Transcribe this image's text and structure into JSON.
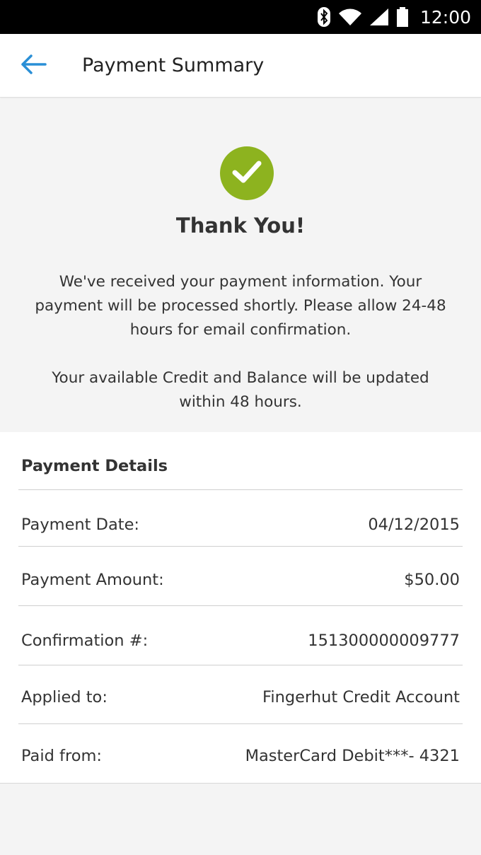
{
  "status_bar": {
    "time": "12:00",
    "icons": [
      "bluetooth-icon",
      "wifi-icon",
      "signal-icon",
      "battery-icon"
    ]
  },
  "app_bar": {
    "title": "Payment Summary",
    "back_icon": "back-arrow-icon"
  },
  "hero": {
    "icon": "check-icon",
    "title": "Thank You!",
    "message_1": "We've received your payment information. Your payment will be processed shortly. Please allow 24-48 hours for email confirmation.",
    "message_2": "Your available Credit and Balance will be updated within 48 hours."
  },
  "payment_details": {
    "header": "Payment Details",
    "rows": [
      {
        "label": "Payment Date:",
        "value": "04/12/2015"
      },
      {
        "label": "Payment Amount:",
        "value": "$50.00"
      },
      {
        "label": "Confirmation #:",
        "value": "151300000009777"
      },
      {
        "label": "Applied to:",
        "value": "Fingerhut Credit Account"
      },
      {
        "label": "Paid from:",
        "value": "MasterCard Debit***- 4321"
      }
    ]
  },
  "colors": {
    "accent_blue": "#2a8fd6",
    "success_green": "#8db31f",
    "text": "#333333",
    "background": "#f4f4f4"
  }
}
